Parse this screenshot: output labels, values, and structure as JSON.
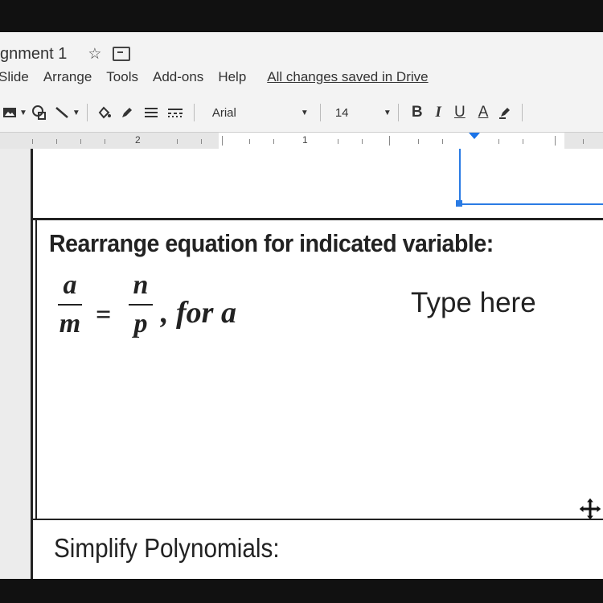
{
  "window": {
    "doc_title": "gnment 1",
    "star_icon": "star-icon",
    "folder_icon": "move-to-folder-icon"
  },
  "menu": {
    "items": [
      "Slide",
      "Arrange",
      "Tools",
      "Add-ons",
      "Help"
    ],
    "save_status": "All changes saved in Drive"
  },
  "toolbar": {
    "font": "Arial",
    "font_size": "14",
    "bold": "B",
    "italic": "I",
    "underline": "U",
    "text_color": "A"
  },
  "ruler": {
    "labels": [
      "2",
      "1"
    ]
  },
  "slide": {
    "heading": "Rearrange equation for indicated variable:",
    "equation": {
      "left_numerator": "a",
      "left_denominator": "m",
      "equals": "=",
      "right_numerator": "n",
      "right_denominator": "p",
      "suffix": ", for a"
    },
    "answer_box": "Type here",
    "next_heading": "Simplify Polynomials:"
  },
  "colors": {
    "accent": "#2a7be4",
    "text": "#222222"
  }
}
